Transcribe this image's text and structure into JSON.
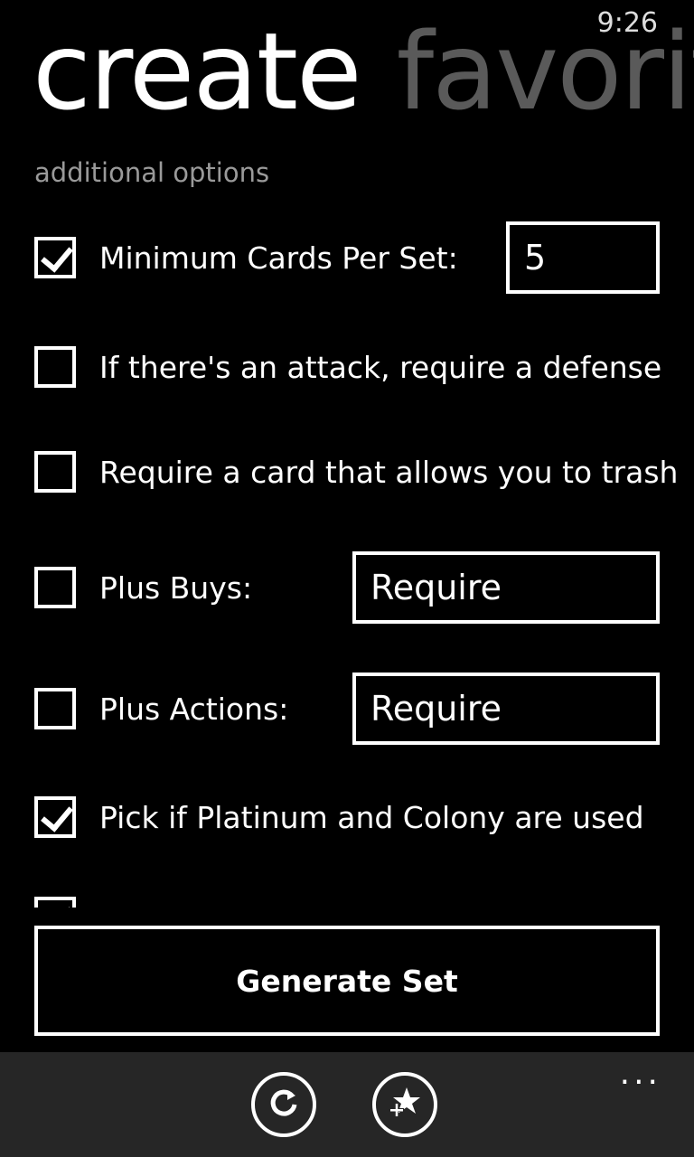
{
  "status": {
    "time": "9:26"
  },
  "pivot": {
    "active": "create",
    "inactive": "favorites"
  },
  "section": {
    "label": "additional options"
  },
  "options": [
    {
      "label": "Minimum Cards Per Set:",
      "checked": true,
      "value": "5"
    },
    {
      "label": "If there's an attack, require a defense",
      "checked": false
    },
    {
      "label": "Require a card that allows you to trash",
      "checked": false
    },
    {
      "label": "Plus Buys:",
      "checked": false,
      "value": "Require"
    },
    {
      "label": "Plus Actions:",
      "checked": false,
      "value": "Require"
    },
    {
      "label": "Pick if Platinum and Colony are used",
      "checked": true
    }
  ],
  "generate_button": {
    "label": "Generate Set"
  },
  "app_bar": {
    "buttons": [
      {
        "icon": "refresh-icon"
      },
      {
        "icon": "add-favorite-icon"
      }
    ],
    "more": "..."
  }
}
